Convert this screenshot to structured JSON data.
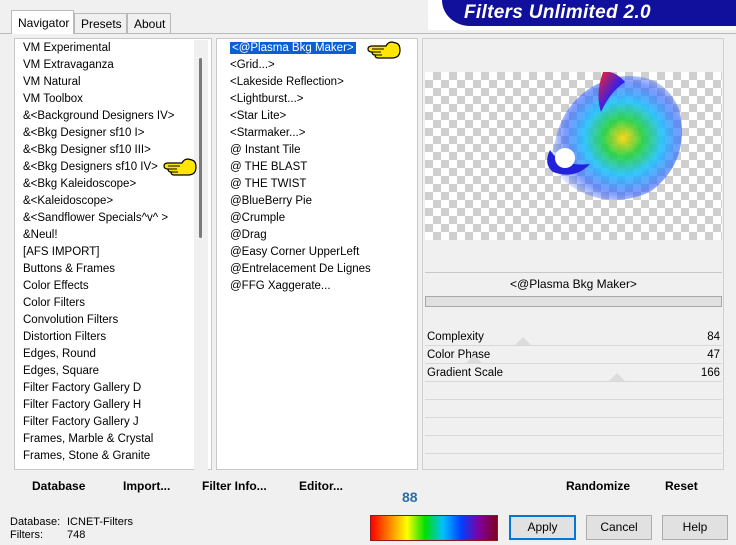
{
  "tabs": [
    "Navigator",
    "Presets",
    "About"
  ],
  "banner_title": "Filters Unlimited 2.0",
  "categories": [
    "VM Experimental",
    "VM Extravaganza",
    "VM Natural",
    "VM Toolbox",
    "&<Background Designers IV>",
    "&<Bkg Designer sf10 I>",
    "&<Bkg Designer sf10 III>",
    "&<Bkg Designers sf10 IV>",
    "&<Bkg Kaleidoscope>",
    "&<Kaleidoscope>",
    "&<Sandflower Specials^v^ >",
    "&Neul!",
    "[AFS IMPORT]",
    "Buttons & Frames",
    "Color Effects",
    "Color Filters",
    "Convolution Filters",
    "Distortion Filters",
    "Edges, Round",
    "Edges, Square",
    "Filter Factory Gallery D",
    "Filter Factory Gallery H",
    "Filter Factory Gallery J",
    "Frames, Marble & Crystal",
    "Frames, Stone & Granite"
  ],
  "filters": [
    "<@Plasma Bkg Maker>",
    "<Grid...>",
    "<Lakeside Reflection>",
    "<Lightburst...>",
    "<Star Lite>",
    "<Starmaker...>",
    "@ Instant Tile",
    "@ THE BLAST",
    "@ THE TWIST",
    "@BlueBerry Pie",
    "@Crumple",
    "@Drag",
    "@Easy Corner UpperLeft",
    "@Entrelacement De Lignes",
    "@FFG Xaggerate..."
  ],
  "selected_filter_index": 0,
  "current_filter": "<@Plasma Bkg Maker>",
  "params": [
    {
      "label": "Complexity",
      "value": "84"
    },
    {
      "label": "Color Phase",
      "value": "47"
    },
    {
      "label": "Gradient Scale",
      "value": "166"
    }
  ],
  "buttons": {
    "database": "Database",
    "import": "Import...",
    "filter_info": "Filter Info...",
    "editor": "Editor...",
    "randomize": "Randomize",
    "reset": "Reset",
    "apply": "Apply",
    "cancel": "Cancel",
    "help": "Help"
  },
  "zoom_value": "88",
  "status": {
    "database_label": "Database:",
    "database_value": "ICNET-Filters",
    "filters_label": "Filters:",
    "filters_value": "748"
  },
  "colors": {
    "banner": "#10109c",
    "selection": "#0b5fd4",
    "accent": "#0078d7"
  }
}
